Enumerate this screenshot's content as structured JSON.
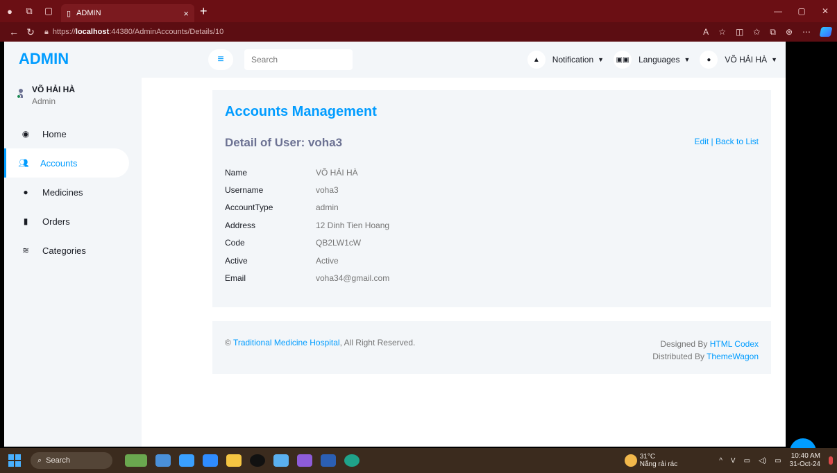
{
  "browser": {
    "tab_title": "ADMIN",
    "url_prefix": "https://",
    "url_host": "localhost",
    "url_rest": ":44380/AdminAccounts/Details/10"
  },
  "sidebar": {
    "brand": "ADMIN",
    "user_name": "VÕ HẢI HÀ",
    "user_role": "Admin",
    "items": [
      {
        "label": "Home",
        "icon": "tachometer-icon"
      },
      {
        "label": "Accounts",
        "icon": "users-icon",
        "active": true
      },
      {
        "label": "Medicines",
        "icon": "pills-icon"
      },
      {
        "label": "Orders",
        "icon": "clipboard-icon"
      },
      {
        "label": "Categories",
        "icon": "layers-icon"
      }
    ]
  },
  "topbar": {
    "search_placeholder": "Search",
    "notification_label": "Notification",
    "languages_label": "Languages",
    "user_label": "VÕ HẢI HÀ"
  },
  "card": {
    "title": "Accounts Management",
    "subtitle": "Detail of User: voha3",
    "edit_link": "Edit",
    "separator": " | ",
    "back_link": "Back to List",
    "fields": [
      {
        "label": "Name",
        "value": "VÕ HẢI HÀ"
      },
      {
        "label": "Username",
        "value": "voha3"
      },
      {
        "label": "AccountType",
        "value": "admin"
      },
      {
        "label": "Address",
        "value": "12 Dinh Tien Hoang"
      },
      {
        "label": "Code",
        "value": "QB2LW1cW"
      },
      {
        "label": "Active",
        "value": "Active"
      },
      {
        "label": "Email",
        "value": "voha34@gmail.com"
      }
    ]
  },
  "footer": {
    "copyright_symbol": "© ",
    "site_name": "Traditional Medicine Hospital",
    "rights": ", All Right Reserved.",
    "designed_by": "Designed By ",
    "designer": "HTML Codex",
    "distributed_by": "Distributed By ",
    "distributor": "ThemeWagon"
  },
  "taskbar": {
    "search_label": "Search",
    "temperature": "31°C",
    "weather_text": "Nắng rải rác",
    "time": "10:40 AM",
    "date": "31-Oct-24"
  },
  "colors": {
    "accent": "#009cff",
    "sidebar_bg": "#f3f6f9",
    "browser_chrome": "#6b0f14"
  }
}
